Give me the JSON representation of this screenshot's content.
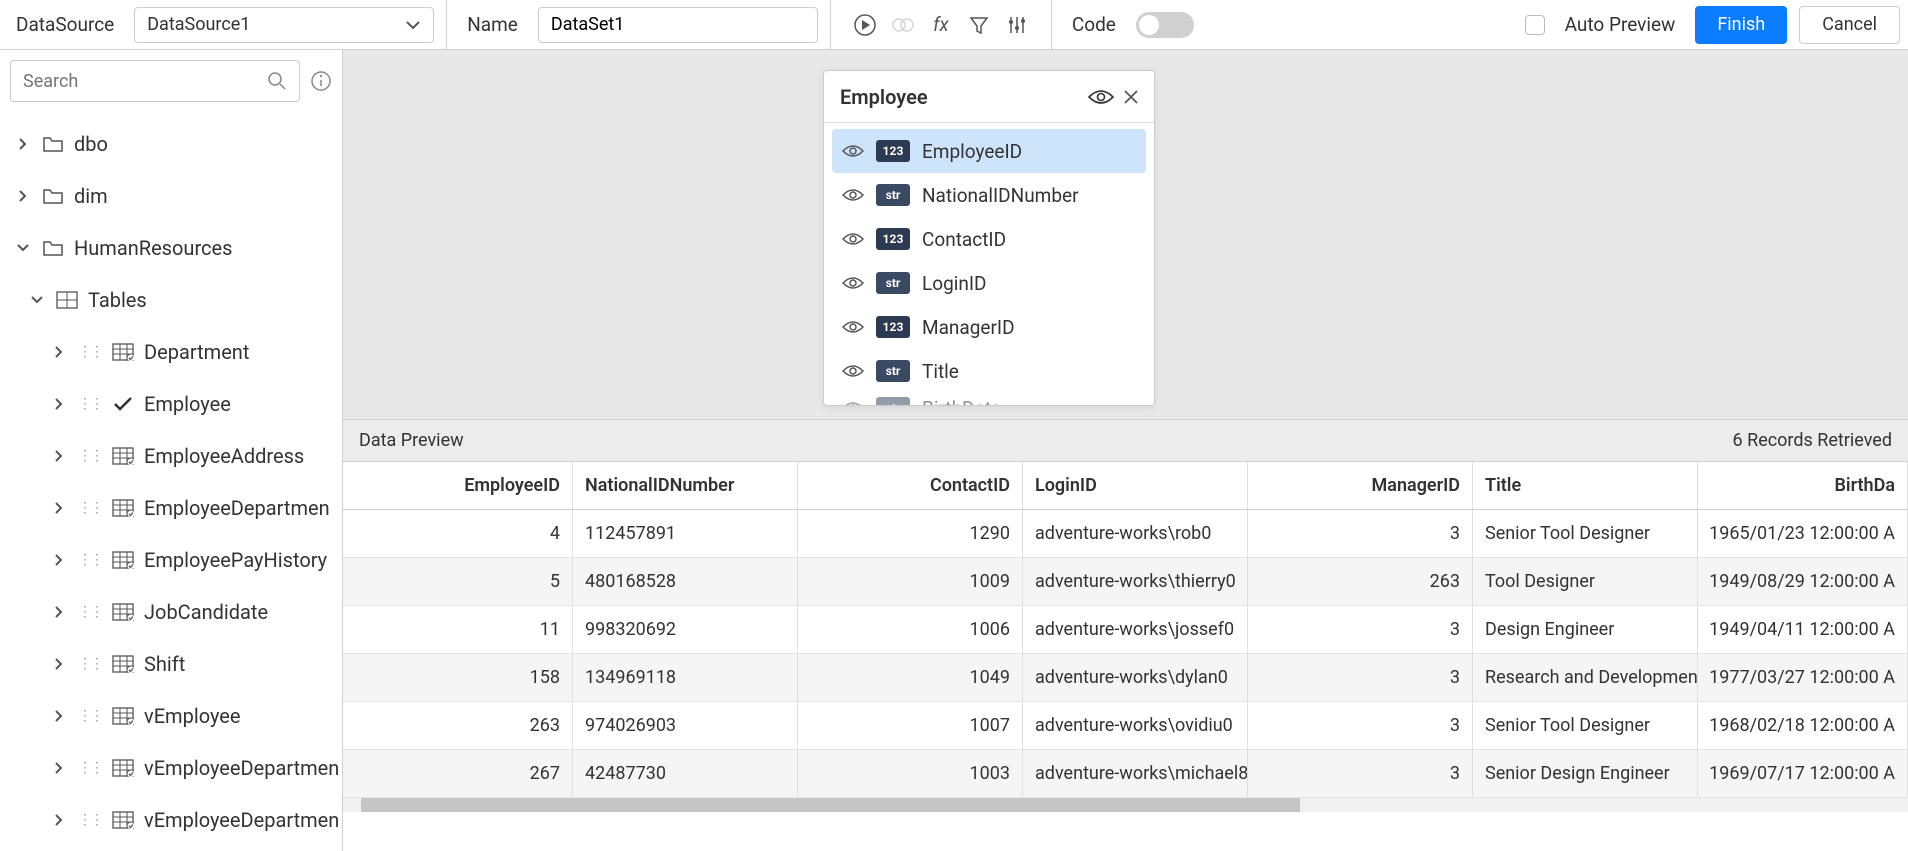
{
  "toolbar": {
    "datasource_label": "DataSource",
    "datasource_value": "DataSource1",
    "name_label": "Name",
    "name_value": "DataSet1",
    "code_label": "Code",
    "autopreview_label": "Auto Preview",
    "finish_label": "Finish",
    "cancel_label": "Cancel"
  },
  "search": {
    "placeholder": "Search"
  },
  "tree": {
    "items": [
      {
        "level": 0,
        "icon": "folder",
        "label": "dbo",
        "open": false
      },
      {
        "level": 0,
        "icon": "folder",
        "label": "dim",
        "open": false
      },
      {
        "level": 0,
        "icon": "folder",
        "label": "HumanResources",
        "open": true
      },
      {
        "level": 1,
        "icon": "tables",
        "label": "Tables",
        "open": true
      },
      {
        "level": 2,
        "icon": "table",
        "label": "Department",
        "open": false,
        "grip": true
      },
      {
        "level": 2,
        "icon": "check",
        "label": "Employee",
        "open": false,
        "grip": true
      },
      {
        "level": 2,
        "icon": "table",
        "label": "EmployeeAddress",
        "open": false,
        "grip": true
      },
      {
        "level": 2,
        "icon": "table",
        "label": "EmployeeDepartmen",
        "open": false,
        "grip": true
      },
      {
        "level": 2,
        "icon": "table",
        "label": "EmployeePayHistory",
        "open": false,
        "grip": true
      },
      {
        "level": 2,
        "icon": "table",
        "label": "JobCandidate",
        "open": false,
        "grip": true
      },
      {
        "level": 2,
        "icon": "table",
        "label": "Shift",
        "open": false,
        "grip": true
      },
      {
        "level": 2,
        "icon": "table",
        "label": "vEmployee",
        "open": false,
        "grip": true
      },
      {
        "level": 2,
        "icon": "table",
        "label": "vEmployeeDepartmen",
        "open": false,
        "grip": true
      },
      {
        "level": 2,
        "icon": "table",
        "label": "vEmployeeDepartmen",
        "open": false,
        "grip": true
      }
    ]
  },
  "field_panel": {
    "title": "Employee",
    "fields": [
      {
        "type": "123",
        "label": "EmployeeID",
        "selected": true
      },
      {
        "type": "str",
        "label": "NationalIDNumber"
      },
      {
        "type": "123",
        "label": "ContactID"
      },
      {
        "type": "str",
        "label": "LoginID"
      },
      {
        "type": "123",
        "label": "ManagerID"
      },
      {
        "type": "str",
        "label": "Title"
      },
      {
        "type": "str",
        "label": "BirthDate",
        "partial": true
      }
    ]
  },
  "preview": {
    "label": "Data Preview",
    "status": "6 Records Retrieved",
    "columns": [
      "EmployeeID",
      "NationalIDNumber",
      "ContactID",
      "LoginID",
      "ManagerID",
      "Title",
      "BirthDa"
    ],
    "column_align": [
      "num",
      "str",
      "num",
      "str",
      "num",
      "str",
      "num"
    ],
    "rows": [
      [
        "4",
        "112457891",
        "1290",
        "adventure-works\\rob0",
        "3",
        "Senior Tool Designer",
        "1965/01/23 12:00:00 A"
      ],
      [
        "5",
        "480168528",
        "1009",
        "adventure-works\\thierry0",
        "263",
        "Tool Designer",
        "1949/08/29 12:00:00 A"
      ],
      [
        "11",
        "998320692",
        "1006",
        "adventure-works\\jossef0",
        "3",
        "Design Engineer",
        "1949/04/11 12:00:00 A"
      ],
      [
        "158",
        "134969118",
        "1049",
        "adventure-works\\dylan0",
        "3",
        "Research and Developmen",
        "1977/03/27 12:00:00 A"
      ],
      [
        "263",
        "974026903",
        "1007",
        "adventure-works\\ovidiu0",
        "3",
        "Senior Tool Designer",
        "1968/02/18 12:00:00 A"
      ],
      [
        "267",
        "42487730",
        "1003",
        "adventure-works\\michael8",
        "3",
        "Senior Design Engineer",
        "1969/07/17 12:00:00 A"
      ]
    ]
  }
}
